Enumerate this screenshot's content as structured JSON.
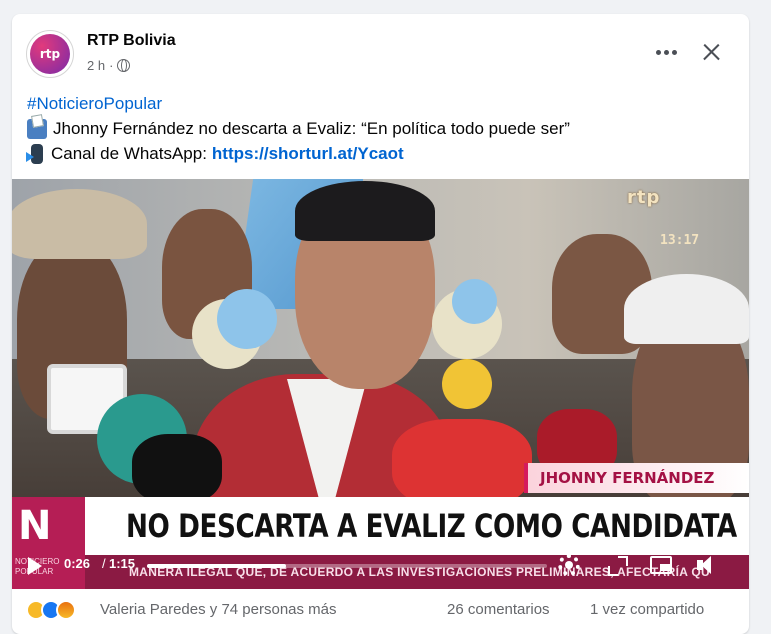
{
  "post": {
    "author": "RTP Bolivia",
    "avatar_text": "rtp",
    "timestamp": "2 h",
    "separator": "·",
    "audience_icon": "globe-icon",
    "hashtag": "#NoticieroPopular",
    "line1_text": "Jhonny Fernández no descarta a Evaliz: “En política todo puede ser”",
    "line2_text": "Canal de WhatsApp:",
    "line2_link": "https://shorturl.at/Ycaot",
    "line1_emoji": "ballot-box-icon",
    "line2_emoji": "mobile-arrow-icon"
  },
  "video": {
    "channel_logo": "rtp",
    "clock": "13:17",
    "name_caption": "JHONNY FERNÁNDEZ",
    "headline": "NO DESCARTA A EVALIZ COMO CANDIDATA",
    "brand_letter": "N",
    "brand_caption": "NOTICIERO POPULAR",
    "ticker": "MANERA ILEGAL QUE, DE ACUERDO A LAS INVESTIGACIONES PRELIMINARES, AFECTARÍA QU",
    "current_time": "0:26",
    "time_separator": "/",
    "total_time": "1:15",
    "progress_fraction": 0.347
  },
  "footer": {
    "reaction_icons": [
      "haha-icon",
      "like-icon",
      "angry-icon"
    ],
    "reactions_text": "Valeria Paredes y 74 personas más",
    "comments": "26 comentarios",
    "shares": "1 vez compartido"
  },
  "colors": {
    "link": "#0064d1",
    "brand": "#b51e55",
    "name_text": "#a41144"
  }
}
